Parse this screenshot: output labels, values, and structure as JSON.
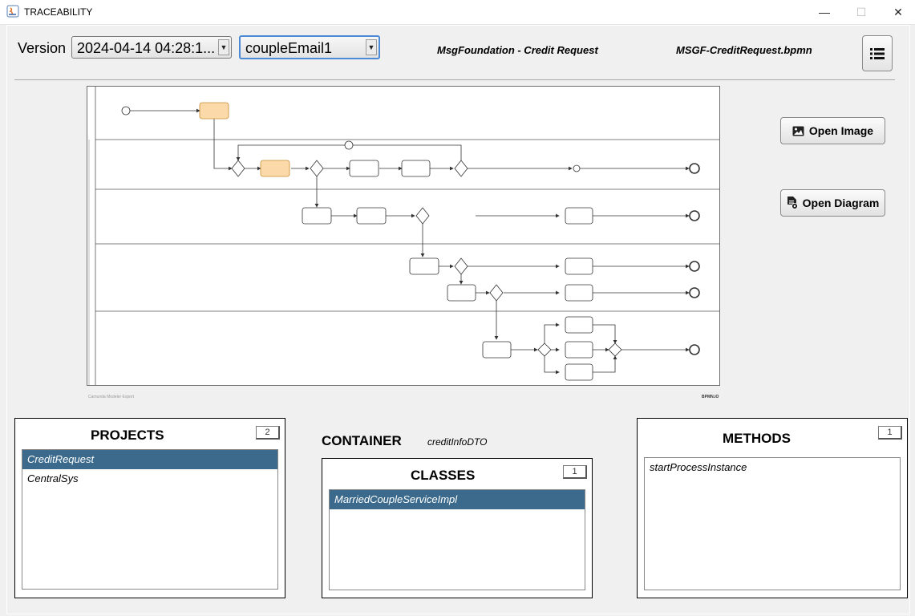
{
  "window": {
    "title": "TRACEABILITY",
    "minimize": "—",
    "maximize": "☐",
    "close": "✕"
  },
  "toolbar": {
    "version_label": "Version",
    "version_value": "2024-04-14 04:28:1...",
    "method_value": "coupleEmail1",
    "process_name": "MsgFoundation - Credit Request",
    "file_name": "MSGF-CreditRequest.bpmn"
  },
  "diagram": {
    "footer_left": "Camunda Modeler Export",
    "footer_right": "BPMN.iO"
  },
  "actions": {
    "open_image": "Open Image",
    "open_diagram": "Open Diagram"
  },
  "projects": {
    "title": "PROJECTS",
    "count": "2",
    "items": [
      "CreditRequest",
      "CentralSys"
    ],
    "selected_index": 0
  },
  "container": {
    "label": "CONTAINER",
    "value": "creditInfoDTO"
  },
  "classes": {
    "title": "CLASSES",
    "count": "1",
    "items": [
      "MarriedCoupleServiceImpl"
    ],
    "selected_index": 0
  },
  "methods": {
    "title": "METHODS",
    "count": "1",
    "items": [
      "startProcessInstance"
    ],
    "selected_index": -1
  },
  "colors": {
    "selection": "#3b6a8c",
    "task_highlight": "#fcd9a8",
    "focus_border": "#4d8ad6"
  }
}
